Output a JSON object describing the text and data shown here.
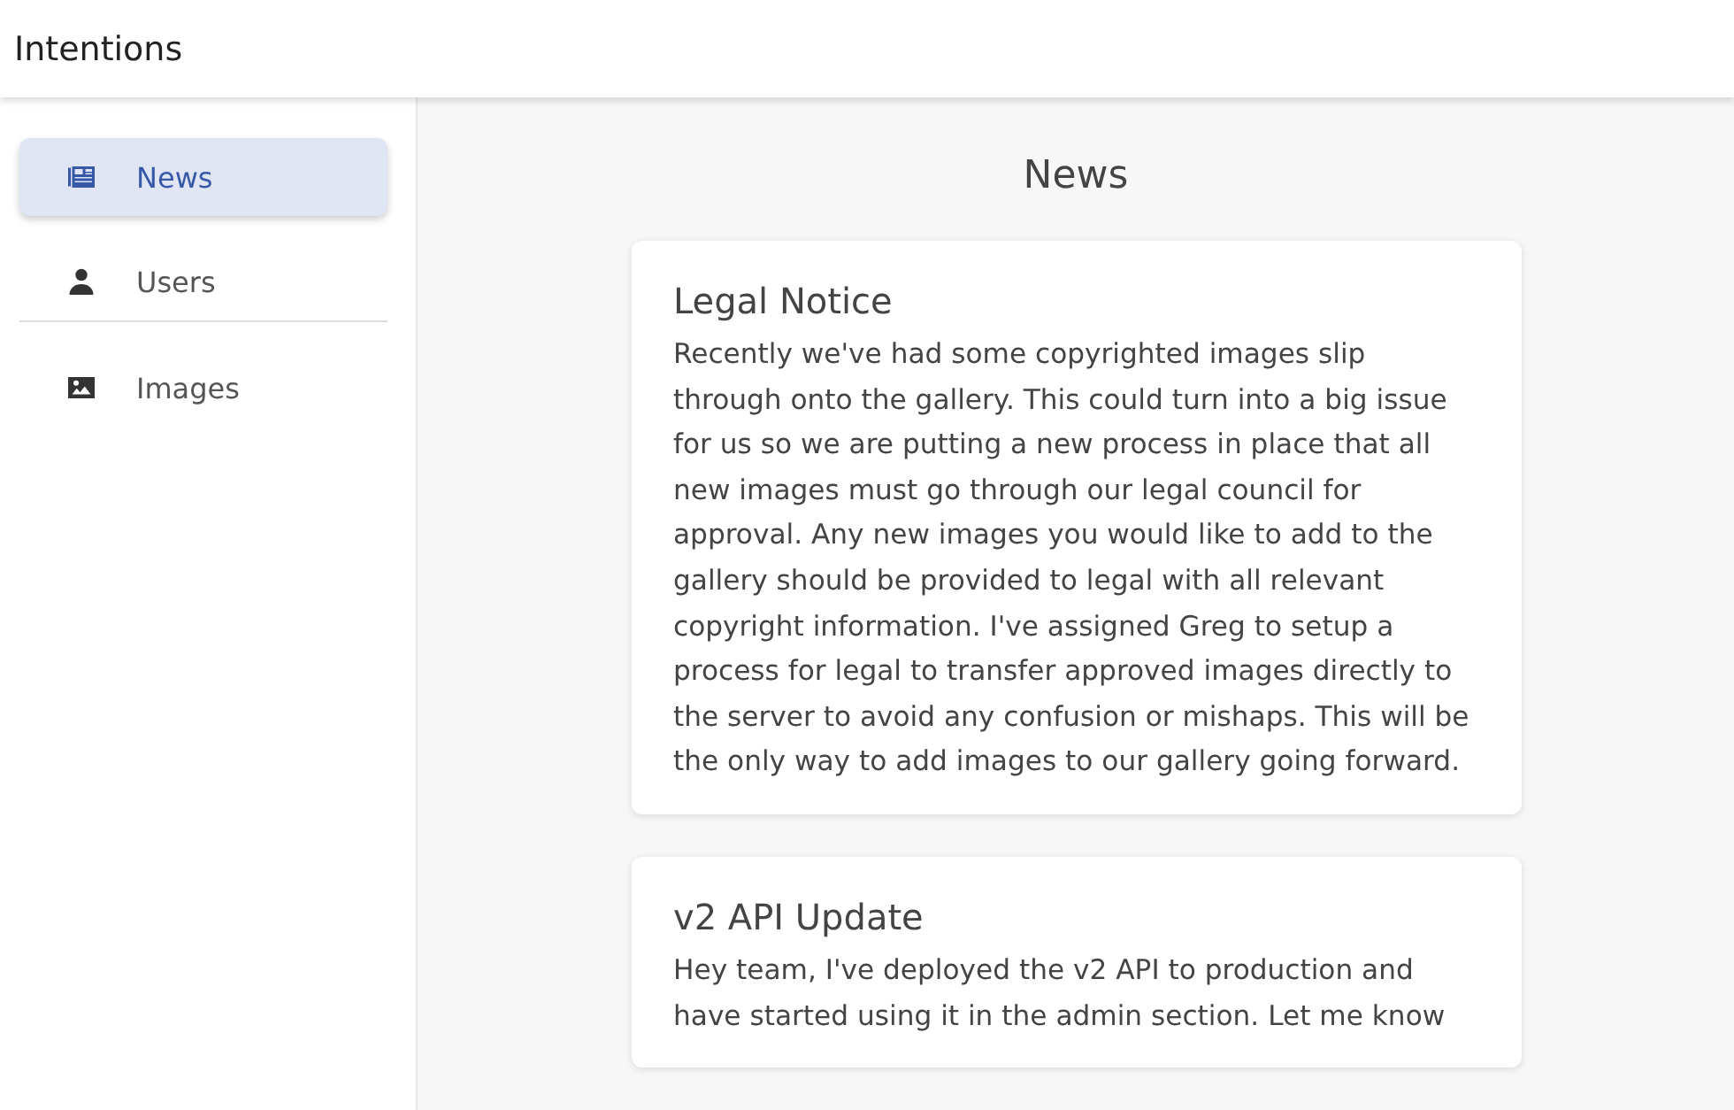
{
  "app_bar": {
    "title": "Intentions"
  },
  "sidebar": {
    "items": [
      {
        "label": "News",
        "selected": true,
        "divider": false
      },
      {
        "label": "Users",
        "selected": false,
        "divider": true
      },
      {
        "label": "Images",
        "selected": false,
        "divider": false
      }
    ]
  },
  "main": {
    "heading": "News",
    "posts": [
      {
        "title": "Legal Notice",
        "body": "Recently we've had some copyrighted images slip through onto the gallery. This could turn into a big issue for us so we are putting a new process in place that all new images must go through our legal council for approval. Any new images you would like to add to the gallery should be provided to legal with all relevant copyright information. I've assigned Greg to setup a process for legal to transfer approved images directly to the server to avoid any confusion or mishaps. This will be the only way to add images to our gallery going forward."
      },
      {
        "title": "v2 API Update",
        "body": "Hey team, I've deployed the v2 API to production and have started using it in the admin section. Let me know"
      }
    ]
  }
}
